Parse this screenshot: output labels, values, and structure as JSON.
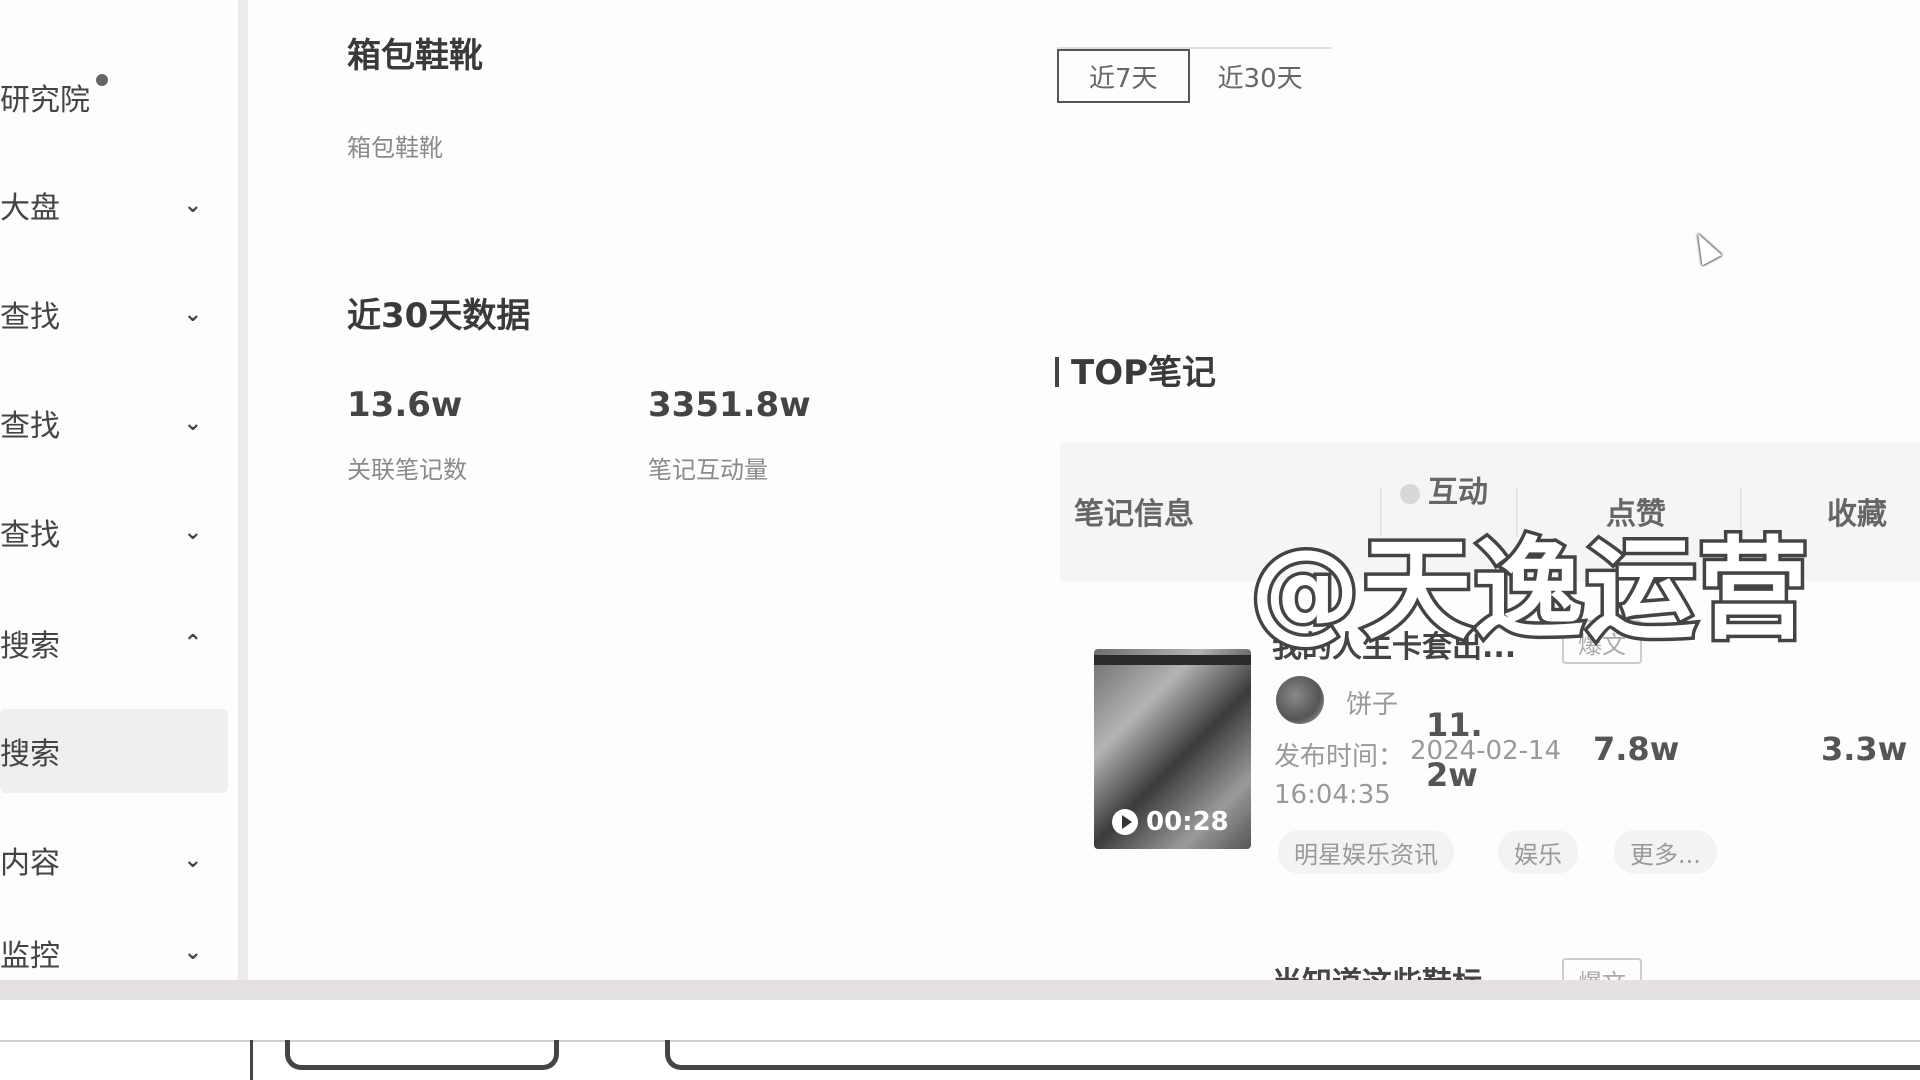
{
  "sidebar": {
    "items": [
      {
        "label": "研究院",
        "chevron": ""
      },
      {
        "label": "大盘",
        "chevron": "⌄"
      },
      {
        "label": "查找",
        "chevron": "⌄"
      },
      {
        "label": "查找",
        "chevron": "⌄"
      },
      {
        "label": "查找",
        "chevron": "⌄"
      },
      {
        "label": "搜索",
        "chevron": "⌃"
      },
      {
        "label": "搜索",
        "chevron": ""
      },
      {
        "label": "内容",
        "chevron": "⌄"
      },
      {
        "label": "监控",
        "chevron": "⌄"
      }
    ]
  },
  "category": {
    "title": "箱包鞋靴",
    "subtitle": "箱包鞋靴"
  },
  "range_tabs": [
    "近7天",
    "近30天"
  ],
  "stats": {
    "title": "近30天数据",
    "items": [
      {
        "value": "13.6w",
        "label": "关联笔记数"
      },
      {
        "value": "3351.8w",
        "label": "笔记互动量"
      }
    ]
  },
  "top_notes": {
    "title": "TOP笔记",
    "headers": {
      "info": "笔记信息",
      "interact": "互动",
      "likes": "点赞",
      "collect": "收藏"
    },
    "rows": [
      {
        "title": "我的人生卡套出...",
        "badge": "爆文",
        "author": "饼子",
        "publish_label": "发布时间：",
        "publish_date": "2024-02-14",
        "publish_time": "16:04:35",
        "interact_line1": "11.",
        "interact_line2": "2w",
        "likes": "7.8w",
        "collect": "3.3w",
        "duration": "00:28",
        "tags": [
          "明星娱乐资讯",
          "娱乐",
          "更多..."
        ]
      },
      {
        "title": "当知道这些鞋标",
        "badge": "爆文"
      }
    ]
  },
  "watermark": "@天逸运营"
}
